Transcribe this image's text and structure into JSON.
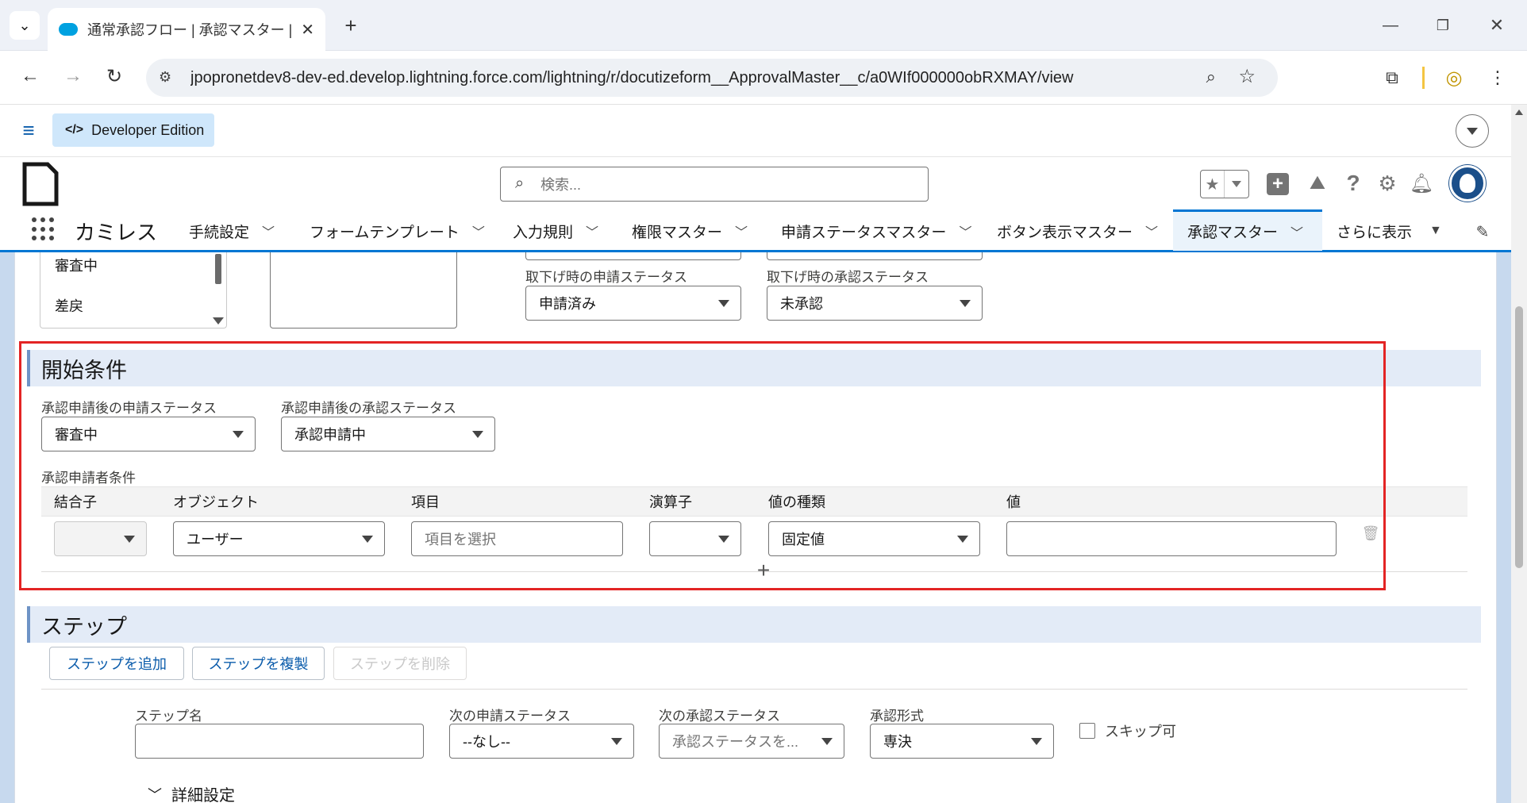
{
  "browser": {
    "tab_title": "通常承認フロー | 承認マスター | Sal",
    "url": "jpopronetdev8-dev-ed.develop.lightning.force.com/lightning/r/docutizeform__ApprovalMaster__c/a0WIf000000obRXMAY/view"
  },
  "org": {
    "badge": "Developer Edition",
    "app_name": "カミレス",
    "search_placeholder": "検索..."
  },
  "nav": {
    "items": [
      "手続設定",
      "フォームテンプレート",
      "入力規則",
      "権限マスター",
      "申請ステータスマスター",
      "ボタン表示マスター",
      "承認マスター"
    ],
    "more": "さらに表示",
    "active": "承認マスター"
  },
  "top_fields": {
    "list_items": [
      "審査中",
      "差戻"
    ],
    "withdraw_app_label": "取下げ時の申請ステータス",
    "withdraw_app_value": "申請済み",
    "withdraw_appr_label": "取下げ時の承認ステータス",
    "withdraw_appr_value": "未承認"
  },
  "start_conditions": {
    "title": "開始条件",
    "after_app_label": "承認申請後の申請ステータス",
    "after_app_value": "審査中",
    "after_appr_label": "承認申請後の承認ステータス",
    "after_appr_value": "承認申請中",
    "applicant_label": "承認申請者条件",
    "columns": [
      "結合子",
      "オブジェクト",
      "項目",
      "演算子",
      "値の種類",
      "値"
    ],
    "row": {
      "object": "ユーザー",
      "field_placeholder": "項目を選択",
      "value_type": "固定値"
    }
  },
  "steps": {
    "title": "ステップ",
    "add": "ステップを追加",
    "copy": "ステップを複製",
    "delete": "ステップを削除",
    "step_name_label": "ステップ名",
    "next_app_label": "次の申請ステータス",
    "next_app_value": "--なし--",
    "next_appr_label": "次の承認ステータス",
    "next_appr_placeholder": "承認ステータスを...",
    "approval_type_label": "承認形式",
    "approval_type_value": "専決",
    "skip_label": "スキップ可",
    "advanced": "詳細設定"
  },
  "colors": {
    "highlight": "#e32424",
    "link": "#0b5cab",
    "brand": "#00a1e0"
  }
}
